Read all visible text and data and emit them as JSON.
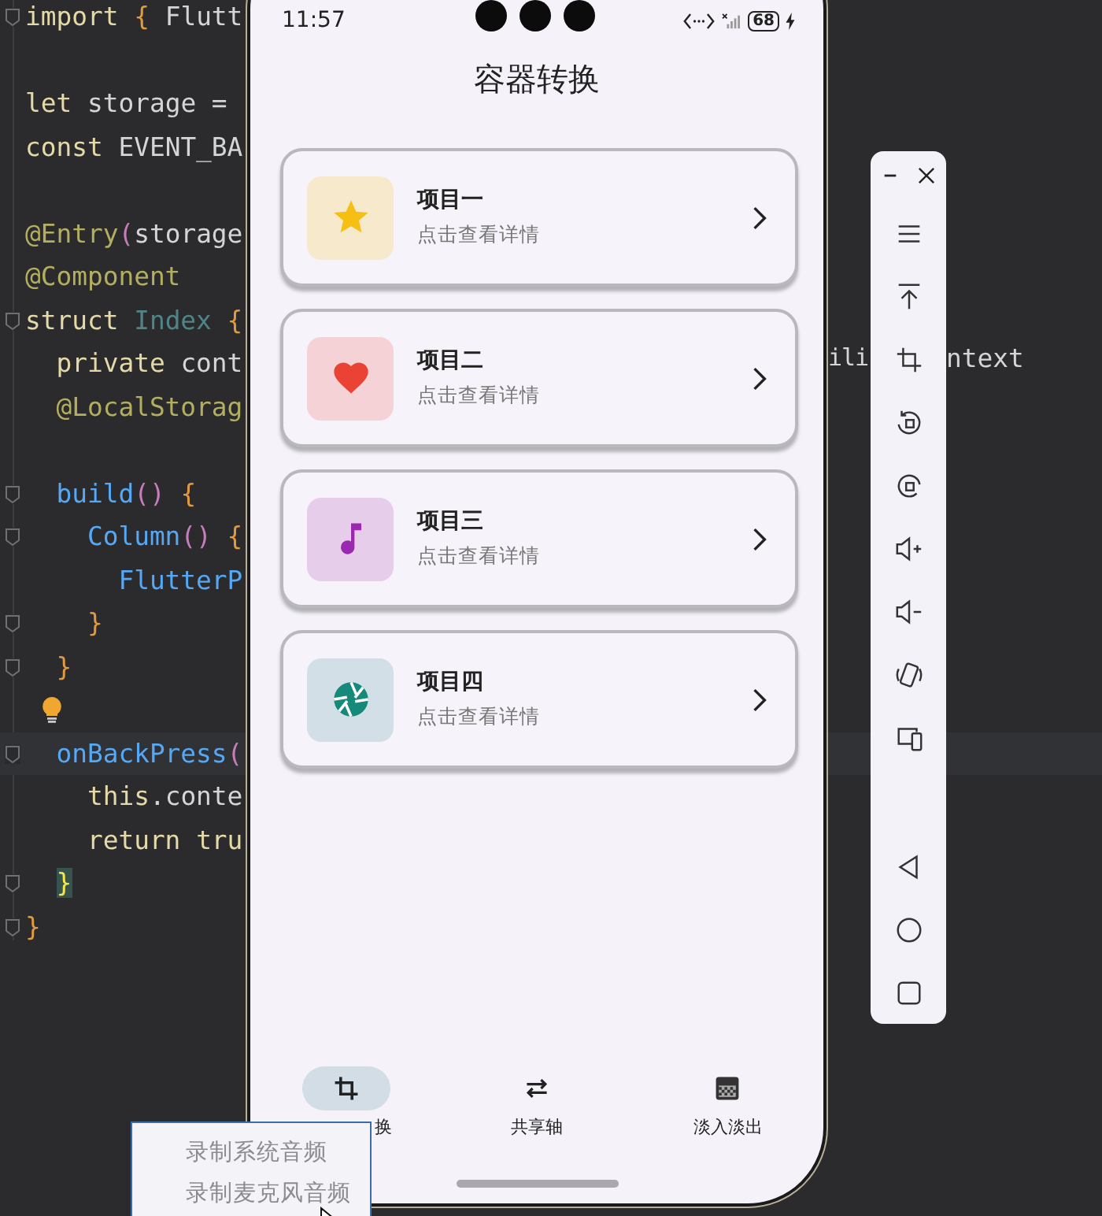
{
  "editor": {
    "blocks": [
      {
        "lines": [
          {
            "fold_marker": true,
            "tokens": [
              {
                "t": "import ",
                "kind": "kw"
              },
              {
                "t": "{ ",
                "kind": "brace"
              },
              {
                "t": "Flutt",
                "kind": "plain"
              }
            ]
          }
        ]
      },
      {
        "lines": [
          {
            "tokens": [
              {
                "t": "let ",
                "kind": "kw"
              },
              {
                "t": "storage =",
                "kind": "plain"
              }
            ]
          },
          {
            "tokens": [
              {
                "t": "const ",
                "kind": "kw"
              },
              {
                "t": "EVENT_BA",
                "kind": "plain"
              }
            ]
          }
        ]
      },
      {
        "lines": [
          {
            "tokens": [
              {
                "t": "@Entry",
                "kind": "deco"
              },
              {
                "t": "(",
                "kind": "paren"
              },
              {
                "t": "storage",
                "kind": "plain"
              }
            ]
          },
          {
            "tokens": [
              {
                "t": "@Component",
                "kind": "deco"
              }
            ]
          },
          {
            "fold_marker": true,
            "tokens": [
              {
                "t": "struct ",
                "kind": "kw"
              },
              {
                "t": "Index ",
                "kind": "type"
              },
              {
                "t": "{",
                "kind": "brace"
              }
            ]
          },
          {
            "tokens": [
              {
                "t": "  private ",
                "kind": "kw"
              },
              {
                "t": "cont",
                "kind": "plain"
              }
            ]
          },
          {
            "tokens": [
              {
                "t": "  @LocalStorag",
                "kind": "deco"
              }
            ]
          }
        ]
      },
      {
        "lines": [
          {
            "fold_marker": true,
            "tokens": [
              {
                "t": "  build",
                "kind": "fn"
              },
              {
                "t": "() ",
                "kind": "paren"
              },
              {
                "t": "{",
                "kind": "brace"
              }
            ]
          },
          {
            "fold_marker": true,
            "tokens": [
              {
                "t": "    Column",
                "kind": "fn"
              },
              {
                "t": "() ",
                "kind": "paren"
              },
              {
                "t": "{",
                "kind": "brace"
              }
            ]
          },
          {
            "tokens": [
              {
                "t": "      FlutterP",
                "kind": "fn"
              }
            ]
          },
          {
            "fold_marker": true,
            "tokens": [
              {
                "t": "    }",
                "kind": "brace"
              }
            ]
          },
          {
            "fold_marker": true,
            "tokens": [
              {
                "t": "  }",
                "kind": "brace"
              }
            ]
          },
          {
            "bulb": true
          },
          {
            "fold_marker": true,
            "current": true,
            "tokens": [
              {
                "t": "  onBackPress",
                "kind": "fn"
              },
              {
                "t": "(",
                "kind": "paren"
              }
            ]
          },
          {
            "tokens": [
              {
                "t": "    this",
                "kind": "kw"
              },
              {
                "t": ".conte",
                "kind": "plain"
              }
            ]
          },
          {
            "tokens": [
              {
                "t": "    return ",
                "kind": "kw"
              },
              {
                "t": "tru",
                "kind": "kw"
              }
            ]
          },
          {
            "fold_marker": true,
            "tokens": [
              {
                "t": "}",
                "kind": "match"
              }
            ]
          },
          {
            "fold_marker": true,
            "tokens": [
              {
                "t": "}",
                "kind": "brace"
              }
            ]
          }
        ]
      }
    ],
    "fragments": [
      "ili",
      "ntext"
    ]
  },
  "phone": {
    "status_bar": {
      "time": "11:57",
      "battery": "68"
    },
    "title": "容器转换",
    "cards": [
      {
        "title": "项目一",
        "subtitle": "点击查看详情",
        "kind": "star",
        "color": "#f7e9cc"
      },
      {
        "title": "项目二",
        "subtitle": "点击查看详情",
        "kind": "heart",
        "color": "#f4d2d6"
      },
      {
        "title": "项目三",
        "subtitle": "点击查看详情",
        "kind": "music",
        "color": "#e6cdea"
      },
      {
        "title": "项目四",
        "subtitle": "点击查看详情",
        "kind": "aperture",
        "color": "#d2dfe6"
      }
    ],
    "tabs": [
      {
        "label": "换",
        "kind": "crop",
        "selected": true,
        "covered": true
      },
      {
        "label": "共享轴",
        "kind": "swap",
        "selected": false
      },
      {
        "label": "淡入淡出",
        "kind": "fade",
        "selected": false
      }
    ]
  },
  "popup": {
    "items": [
      "录制系统音频",
      "录制麦克风音频"
    ]
  },
  "toolbar": {
    "window_controls": [
      {
        "kind": "minimize"
      },
      {
        "kind": "close"
      }
    ],
    "buttons": [
      {
        "kind": "menu"
      },
      {
        "kind": "top"
      },
      {
        "kind": "crop"
      },
      {
        "kind": "rotate-left"
      },
      {
        "kind": "rotate-right"
      },
      {
        "kind": "volume-up"
      },
      {
        "kind": "volume-down"
      },
      {
        "kind": "shake"
      },
      {
        "kind": "devices"
      }
    ],
    "nav_buttons": [
      {
        "kind": "back"
      },
      {
        "kind": "home"
      },
      {
        "kind": "recent"
      }
    ]
  }
}
